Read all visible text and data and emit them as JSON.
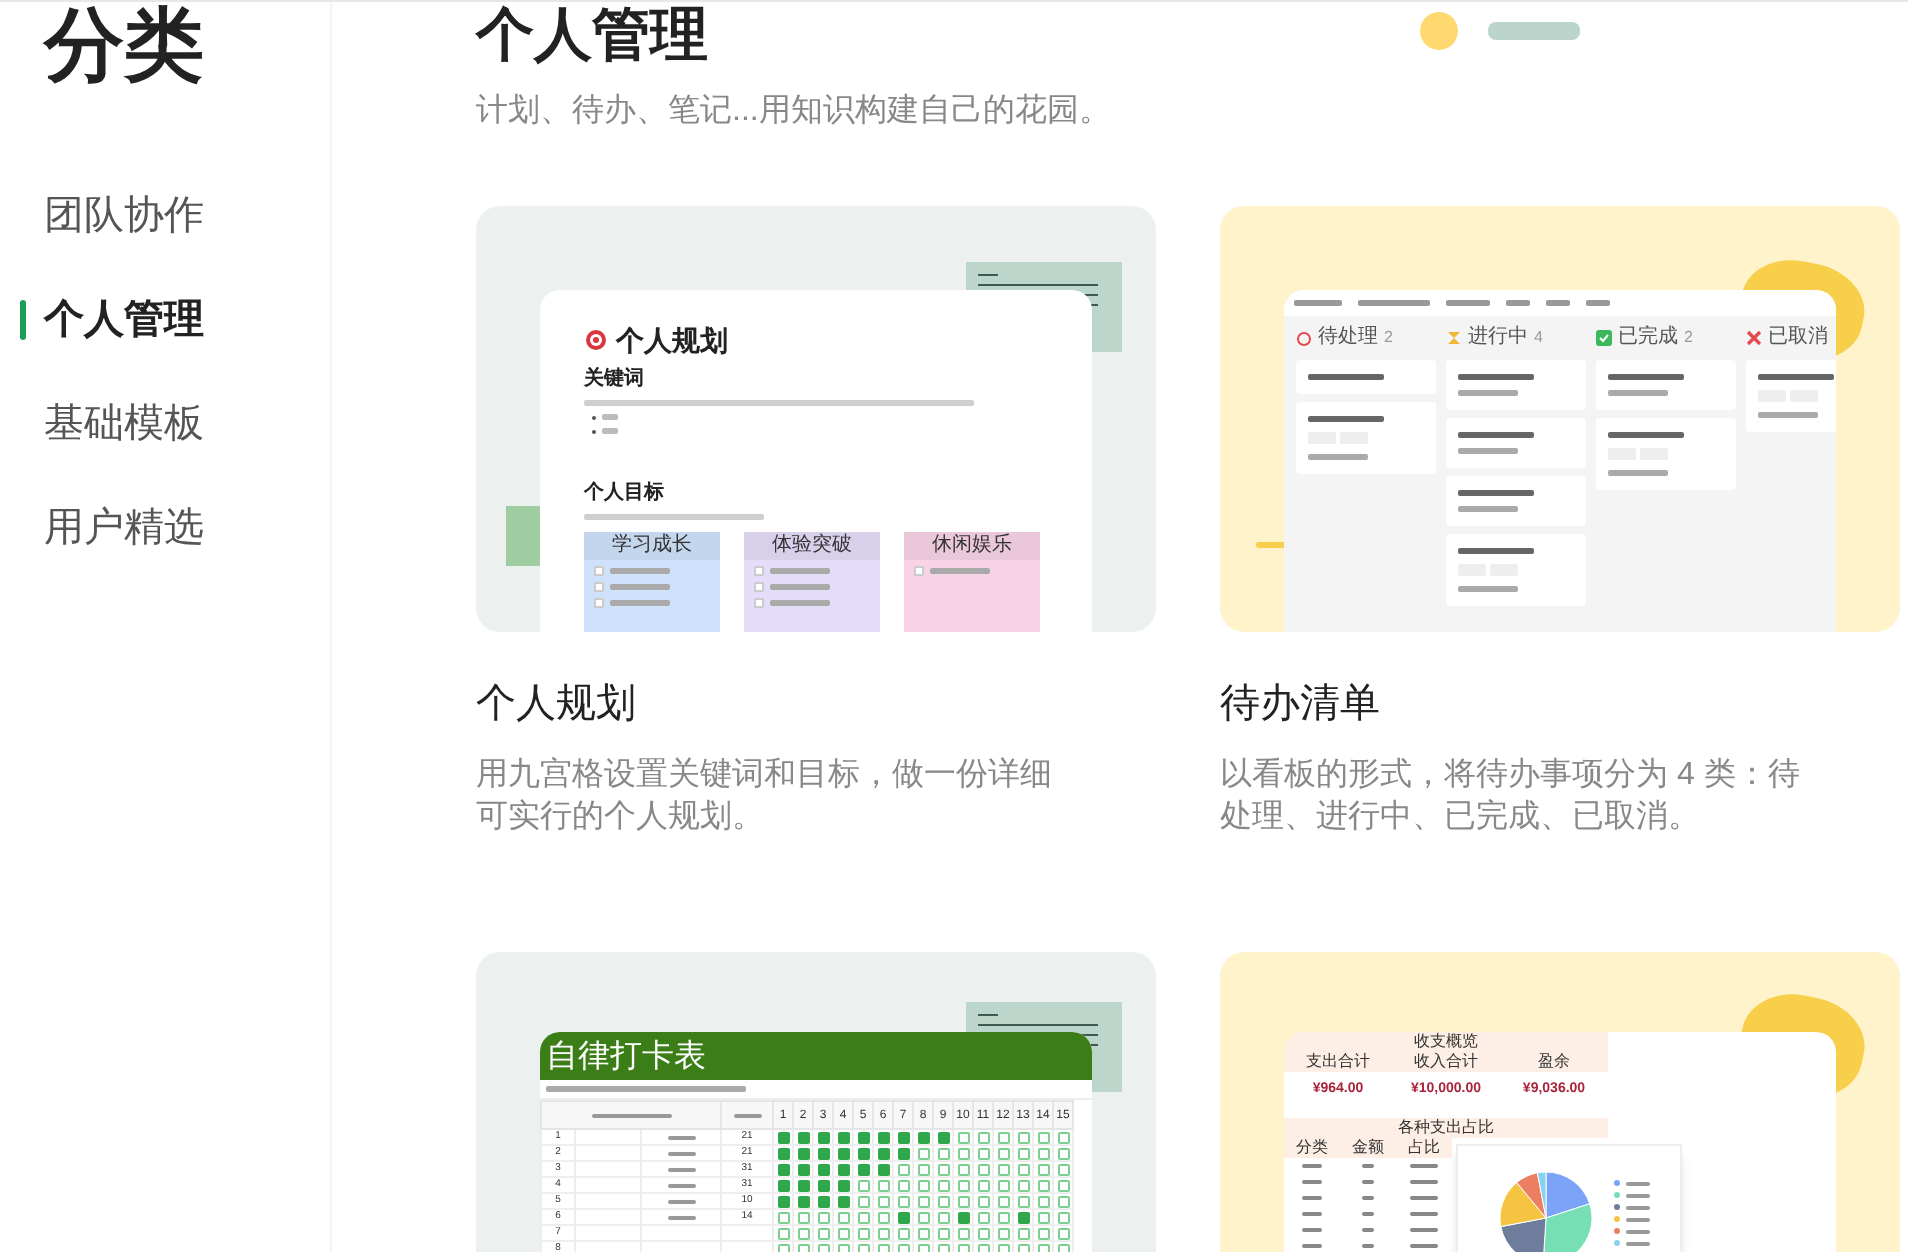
{
  "page_title": "分类",
  "sidebar": {
    "items": [
      {
        "label": "团队协作",
        "selected": false
      },
      {
        "label": "个人管理",
        "selected": true
      },
      {
        "label": "基础模板",
        "selected": false
      },
      {
        "label": "用户精选",
        "selected": false
      }
    ]
  },
  "section": {
    "title": "个人管理",
    "subtitle": "计划、待办、笔记...用知识构建自己的花园。"
  },
  "templates": [
    {
      "kind": "planner",
      "title": "个人规划",
      "description": "用九宫格设置关键词和目标，做一份详细可实行的个人规划。",
      "preview": {
        "doc_title": "个人规划",
        "headings": [
          "关键词",
          "个人目标"
        ],
        "goal_columns": [
          {
            "label": "学习成长",
            "color": "#cfe2fb"
          },
          {
            "label": "体验突破",
            "color": "#e4dcf8"
          },
          {
            "label": "休闲娱乐",
            "color": "#f8d3e5"
          }
        ]
      }
    },
    {
      "kind": "kanban",
      "title": "待办清单",
      "description": "以看板的形式，将待办事项分为 4 类：待处理、进行中、已完成、已取消。",
      "preview": {
        "columns": [
          {
            "kind": "todo",
            "label": "待处理",
            "count": "2",
            "cards": [
              {
                "kind": "title"
              },
              {
                "kind": "tagged"
              }
            ]
          },
          {
            "kind": "doing",
            "label": "进行中",
            "count": "4",
            "cards": [
              {
                "kind": "dated"
              },
              {
                "kind": "dated"
              },
              {
                "kind": "dated"
              },
              {
                "kind": "tagged"
              }
            ]
          },
          {
            "kind": "done",
            "label": "已完成",
            "count": "2",
            "cards": [
              {
                "kind": "dated"
              },
              {
                "kind": "tagged"
              }
            ]
          },
          {
            "kind": "cancelled",
            "label": "已取消",
            "cards": [
              {
                "kind": "tagged"
              }
            ]
          }
        ]
      }
    },
    {
      "kind": "checkin",
      "preview": {
        "sheet_title": "自律打卡表",
        "days": [
          "1",
          "2",
          "3",
          "4",
          "5",
          "6",
          "7",
          "8",
          "9",
          "10",
          "11",
          "12",
          "13",
          "14",
          "15"
        ],
        "rows": [
          {
            "number": "1",
            "target": "21",
            "checked": [
              true,
              true,
              true,
              true,
              true,
              true,
              true,
              true,
              true,
              false,
              false,
              false,
              false,
              false,
              false
            ]
          },
          {
            "number": "2",
            "target": "21",
            "checked": [
              true,
              true,
              true,
              true,
              true,
              true,
              true,
              false,
              false,
              false,
              false,
              false,
              false,
              false,
              false
            ]
          },
          {
            "number": "3",
            "target": "31",
            "checked": [
              true,
              true,
              true,
              true,
              true,
              true,
              false,
              false,
              false,
              false,
              false,
              false,
              false,
              false,
              false
            ]
          },
          {
            "number": "4",
            "target": "31",
            "checked": [
              true,
              true,
              true,
              true,
              false,
              false,
              false,
              false,
              false,
              false,
              false,
              false,
              false,
              false,
              false
            ]
          },
          {
            "number": "5",
            "target": "10",
            "checked": [
              true,
              true,
              true,
              true,
              false,
              false,
              false,
              false,
              false,
              false,
              false,
              false,
              false,
              false,
              false
            ]
          },
          {
            "number": "6",
            "target": "14",
            "checked": [
              false,
              false,
              false,
              false,
              false,
              false,
              true,
              false,
              false,
              true,
              false,
              false,
              true,
              false,
              false
            ]
          },
          {
            "number": "7",
            "checked": [
              false,
              false,
              false,
              false,
              false,
              false,
              false,
              false,
              false,
              false,
              false,
              false,
              false,
              false,
              false
            ]
          },
          {
            "number": "8",
            "checked": [
              false,
              false,
              false,
              false,
              false,
              false,
              false,
              false,
              false,
              false,
              false,
              false,
              false,
              false,
              false
            ]
          }
        ]
      }
    },
    {
      "kind": "budget",
      "preview": {
        "overview_title": "收支概览",
        "totals": [
          {
            "label": "支出合计",
            "value": "¥964.00"
          },
          {
            "label": "收入合计",
            "value": "¥10,000.00"
          },
          {
            "label": "盈余",
            "value": "¥9,036.00"
          }
        ],
        "breakdown_title": "各种支出占比",
        "breakdown_columns": [
          "分类",
          "金额",
          "占比"
        ]
      }
    }
  ]
}
